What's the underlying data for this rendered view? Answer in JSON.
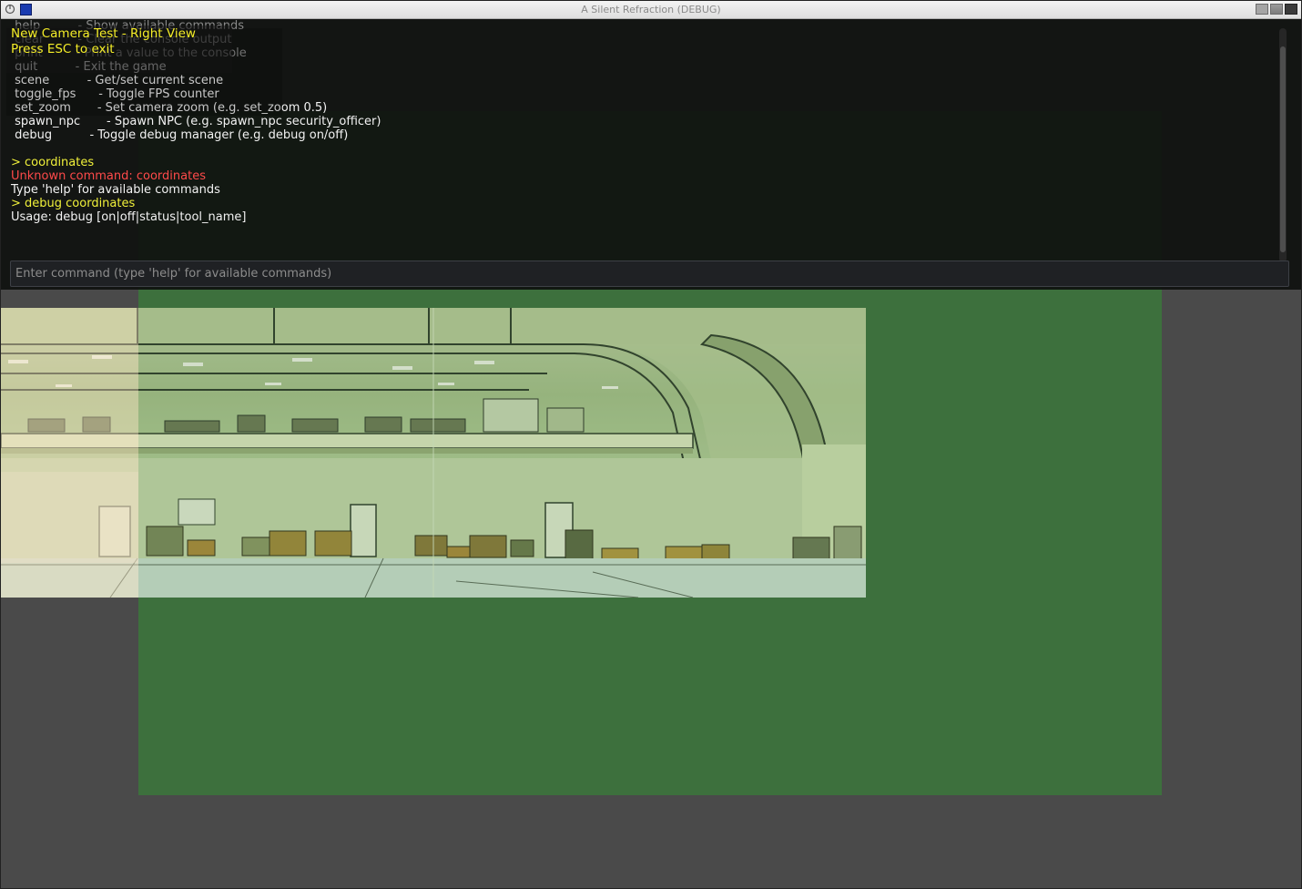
{
  "window": {
    "title": "A Silent Refraction (DEBUG)"
  },
  "hud": {
    "line1": "New Camera Test - Right View",
    "line2": "Press ESC to exit"
  },
  "console": {
    "lines": [
      {
        "text": " help          - Show available commands",
        "style": "dim"
      },
      {
        "text": " clear         - Clear the console output",
        "style": "dim"
      },
      {
        "text": " print         - Print a value to the console",
        "style": "dim"
      },
      {
        "text": " quit          - Exit the game",
        "style": "normal"
      },
      {
        "text": " scene          - Get/set current scene",
        "style": "normal"
      },
      {
        "text": " toggle_fps      - Toggle FPS counter",
        "style": "normal"
      },
      {
        "text": " set_zoom       - Set camera zoom (e.g. set_zoom 0.5)",
        "style": "normal"
      },
      {
        "text": " spawn_npc       - Spawn NPC (e.g. spawn_npc security_officer)",
        "style": "normal"
      },
      {
        "text": " debug          - Toggle debug manager (e.g. debug on/off)",
        "style": "normal"
      },
      {
        "text": "",
        "style": "blank"
      },
      {
        "text": "> coordinates",
        "style": "cmd"
      },
      {
        "text": "Unknown command: coordinates",
        "style": "err"
      },
      {
        "text": "Type 'help' for available commands",
        "style": "normal"
      },
      {
        "text": "> debug coordinates",
        "style": "cmd"
      },
      {
        "text": "Usage: debug [on|off|status|tool_name]",
        "style": "normal"
      }
    ],
    "input_placeholder": "Enter command (type 'help' for available commands)",
    "input_value": ""
  }
}
